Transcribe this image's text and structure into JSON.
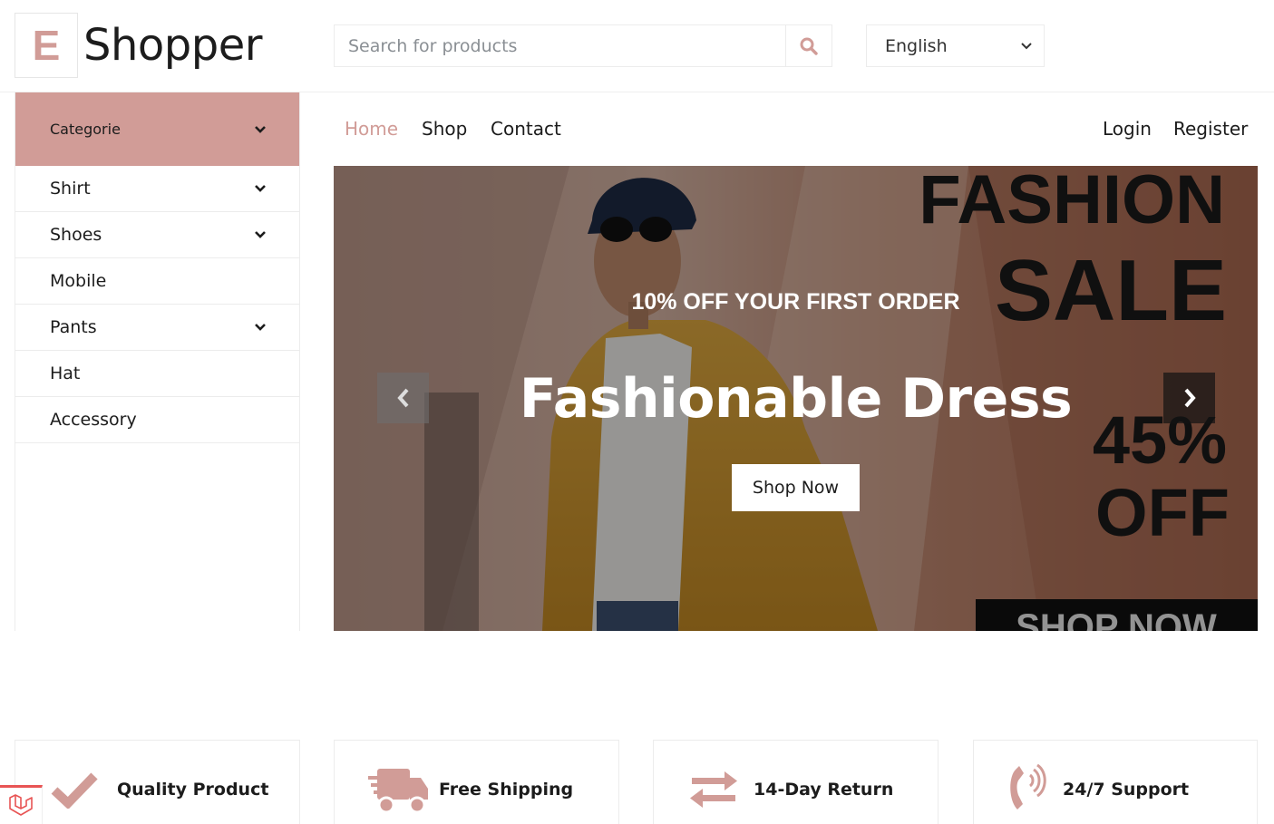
{
  "logo": {
    "letter": "E",
    "text": "Shopper"
  },
  "search": {
    "placeholder": "Search for products"
  },
  "language": {
    "selected": "English"
  },
  "sidebar": {
    "header": "Categorie",
    "items": [
      {
        "label": "Shirt",
        "has_dropdown": true
      },
      {
        "label": "Shoes",
        "has_dropdown": true
      },
      {
        "label": "Mobile",
        "has_dropdown": false
      },
      {
        "label": "Pants",
        "has_dropdown": true
      },
      {
        "label": "Hat",
        "has_dropdown": false
      },
      {
        "label": "Accessory",
        "has_dropdown": false
      }
    ]
  },
  "nav": {
    "links": [
      "Home",
      "Shop",
      "Contact"
    ],
    "active": "Home",
    "auth": [
      "Login",
      "Register"
    ]
  },
  "hero": {
    "subtitle": "10% OFF YOUR FIRST ORDER",
    "title": "Fashionable Dress",
    "button": "Shop Now",
    "poster_text": [
      "FASHION",
      "SALE",
      "45%",
      "OFF",
      "SHOP NOW"
    ]
  },
  "features": [
    {
      "icon": "check-icon",
      "label": "Quality Product"
    },
    {
      "icon": "shipping-truck-icon",
      "label": "Free Shipping"
    },
    {
      "icon": "exchange-arrows-icon",
      "label": "14-Day Return"
    },
    {
      "icon": "phone-volume-icon",
      "label": "24/7 Support"
    }
  ],
  "colors": {
    "accent": "#d19c97",
    "text": "#1c1c1c",
    "border": "#ececec"
  }
}
